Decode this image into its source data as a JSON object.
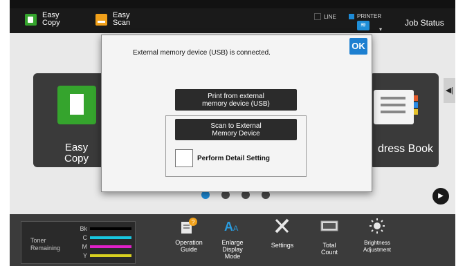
{
  "header": {
    "easy_copy": "Easy\nCopy",
    "easy_scan": "Easy\nScan",
    "line_label": "LINE",
    "printer_label": "PRINTER",
    "job_status": "Job Status"
  },
  "home": {
    "left_tile_label": "Easy\nCopy",
    "right_tile_label": "dress Book",
    "pages": 4,
    "active_page": 1
  },
  "dialog": {
    "message": "External memory device (USB) is connected.",
    "ok": "OK",
    "print_button": "Print from external\nmemory device (USB)",
    "scan_button": "Scan to External\nMemory Device",
    "detail_checkbox_label": "Perform Detail Setting"
  },
  "toner": {
    "title": "Toner\nRemaining",
    "rows": [
      {
        "label": "Bk",
        "color": "#000000"
      },
      {
        "label": "C",
        "color": "#18c7e0"
      },
      {
        "label": "M",
        "color": "#e020c8"
      },
      {
        "label": "Y",
        "color": "#d8d020"
      }
    ]
  },
  "bottom_items": [
    {
      "label": "Operation\nGuide",
      "icon": "operation-guide-icon"
    },
    {
      "label": "Enlarge\nDisplay\nMode",
      "icon": "enlarge-display-icon"
    },
    {
      "label": "Settings",
      "icon": "settings-icon"
    },
    {
      "label": "Total\nCount",
      "icon": "total-count-icon"
    },
    {
      "label": "Brightness\nAdjustment",
      "icon": "brightness-icon"
    }
  ],
  "colors": {
    "accent_blue": "#1d7fd0",
    "green": "#35a42d",
    "orange": "#f0a01a"
  }
}
